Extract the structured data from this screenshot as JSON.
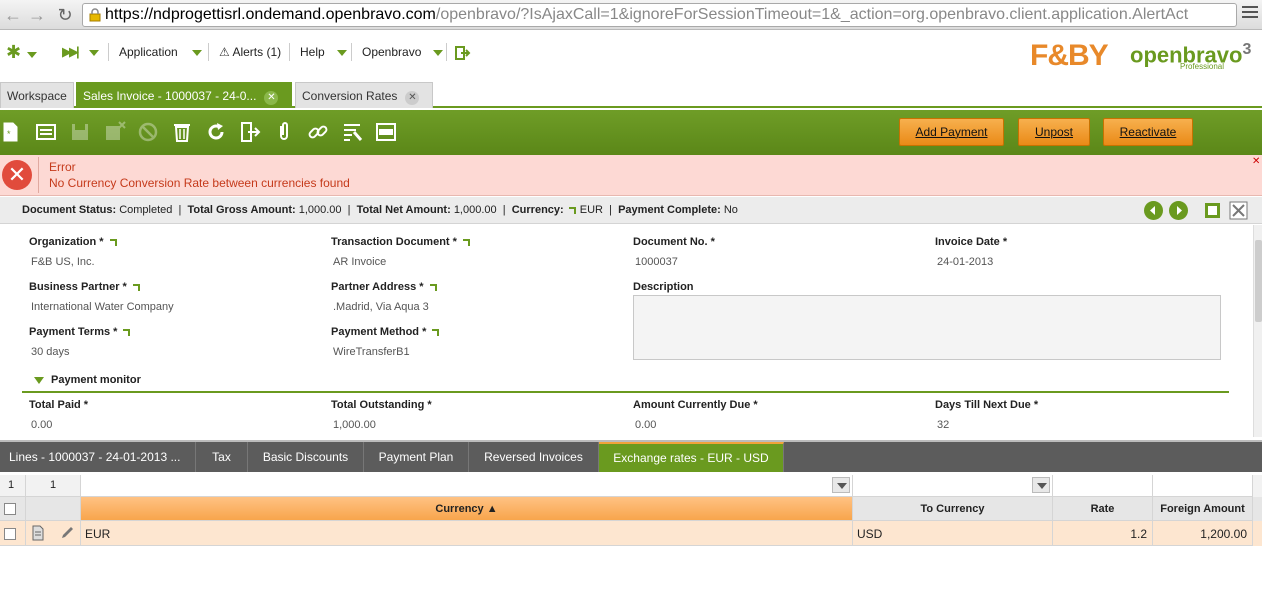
{
  "browser": {
    "url_host": "https://ndprogettisrl.ondemand.openbravo.com",
    "url_path": "/openbravo/?IsAjaxCall=1&ignoreForSessionTimeout=1&_action=org.openbravo.client.application.AlertAct"
  },
  "navbar": {
    "application_label": "Application",
    "alerts_label": "Alerts (1)",
    "help_label": "Help",
    "user_label": "Openbravo",
    "fb_logo": "F&BY",
    "ob_logo": "openbravo",
    "ob_version": "3",
    "ob_edition": "Professional"
  },
  "tabs": [
    {
      "label": "Workspace"
    },
    {
      "label": "Sales Invoice - 1000037 - 24-0..."
    },
    {
      "label": "Conversion Rates"
    }
  ],
  "toolbar": {
    "add_payment": "Add Payment",
    "unpost": "Unpost",
    "reactivate": "Reactivate"
  },
  "error": {
    "title": "Error",
    "message": "No Currency Conversion Rate between currencies found"
  },
  "status": {
    "doc_status_label": "Document Status:",
    "doc_status_value": "Completed",
    "gross_label": "Total Gross Amount:",
    "gross_value": "1,000.00",
    "net_label": "Total Net Amount:",
    "net_value": "1,000.00",
    "currency_label": "Currency:",
    "currency_value": "EUR",
    "payment_complete_label": "Payment Complete:",
    "payment_complete_value": "No"
  },
  "form": {
    "organization_label": "Organization *",
    "organization_value": "F&B US, Inc.",
    "transaction_document_label": "Transaction Document *",
    "transaction_document_value": "AR Invoice",
    "document_no_label": "Document No. *",
    "document_no_value": "1000037",
    "invoice_date_label": "Invoice Date *",
    "invoice_date_value": "24-01-2013",
    "business_partner_label": "Business Partner *",
    "business_partner_value": "International Water Company",
    "partner_address_label": "Partner Address *",
    "partner_address_value": ".Madrid, Via Aqua 3",
    "description_label": "Description",
    "payment_terms_label": "Payment Terms *",
    "payment_terms_value": "30 days",
    "payment_method_label": "Payment Method *",
    "payment_method_value": "WireTransferB1",
    "section_title": "Payment monitor",
    "total_paid_label": "Total Paid *",
    "total_paid_value": "0.00",
    "total_outstanding_label": "Total Outstanding *",
    "total_outstanding_value": "1,000.00",
    "amount_due_label": "Amount Currently Due *",
    "amount_due_value": "0.00",
    "days_next_due_label": "Days Till Next Due *",
    "days_next_due_value": "32"
  },
  "subtabs": [
    {
      "label": "Lines - 1000037 - 24-01-2013 ..."
    },
    {
      "label": "Tax"
    },
    {
      "label": "Basic Discounts"
    },
    {
      "label": "Payment Plan"
    },
    {
      "label": "Reversed Invoices"
    },
    {
      "label": "Exchange rates - EUR - USD"
    }
  ],
  "grid": {
    "filter_count_1": "1",
    "filter_count_2": "1",
    "columns": {
      "currency": "Currency ▲",
      "to_currency": "To Currency",
      "rate": "Rate",
      "foreign_amount": "Foreign Amount"
    },
    "rows": [
      {
        "currency": "EUR",
        "to_currency": "USD",
        "rate": "1.2",
        "foreign_amount": "1,200.00"
      }
    ]
  },
  "colors": {
    "accent_green": "#6a9a1f",
    "action_orange": "#ea8a17",
    "error_bg": "#fdd9d4",
    "error_text": "#c53a1b"
  }
}
